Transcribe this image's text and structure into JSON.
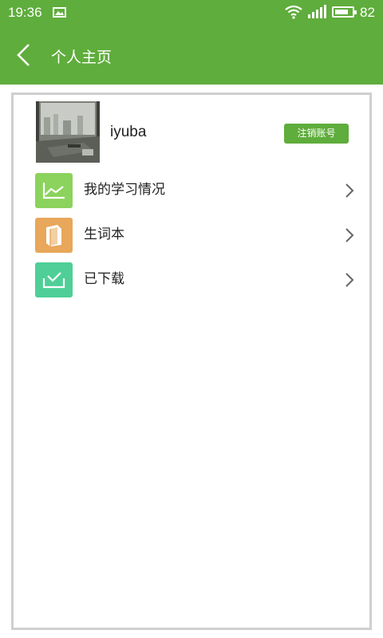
{
  "status_bar": {
    "time": "19:36",
    "battery_level": "82",
    "battery_fraction": 0.82,
    "icons": [
      "image-icon",
      "wifi-icon",
      "signal-icon",
      "battery-icon"
    ]
  },
  "header": {
    "title": "个人主页",
    "back_icon": "chevron-left-icon"
  },
  "profile": {
    "username": "iyuba",
    "logout_label": "注销账号"
  },
  "menu": {
    "items": [
      {
        "label": "我的学习情况",
        "icon": "chart-icon",
        "color": "#8bd35c"
      },
      {
        "label": "生词本",
        "icon": "book-icon",
        "color": "#e8a75a"
      },
      {
        "label": "已下载",
        "icon": "download-tray-icon",
        "color": "#4fcf97"
      }
    ]
  },
  "colors": {
    "accent": "#5fad3c",
    "frame_border": "#cfcfcf"
  }
}
